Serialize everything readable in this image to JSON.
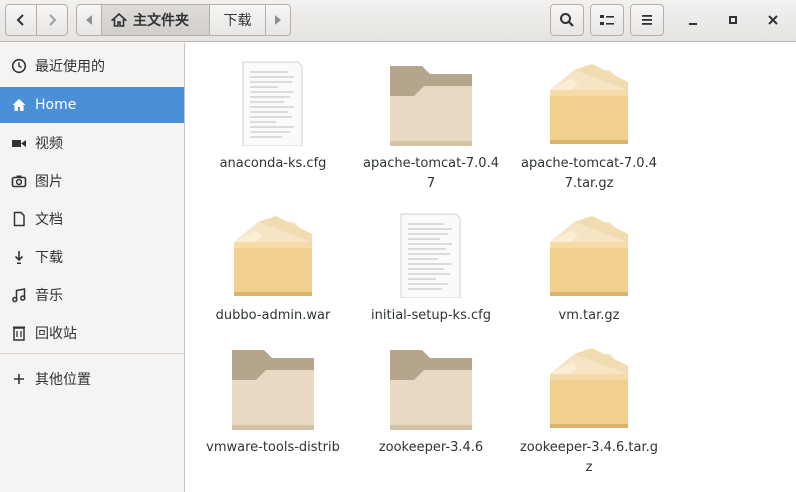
{
  "header": {
    "breadcrumbs": [
      {
        "label": "主文件夹",
        "icon": "home-icon"
      },
      {
        "label": "下载"
      }
    ]
  },
  "sidebar": {
    "items": [
      {
        "label": "最近使用的",
        "icon": "clock-icon"
      },
      {
        "label": "Home",
        "icon": "home-icon",
        "active": true
      },
      {
        "label": "视频",
        "icon": "video-icon"
      },
      {
        "label": "图片",
        "icon": "camera-icon"
      },
      {
        "label": "文档",
        "icon": "document-icon"
      },
      {
        "label": "下载",
        "icon": "download-icon"
      },
      {
        "label": "音乐",
        "icon": "music-icon"
      },
      {
        "label": "回收站",
        "icon": "trash-icon"
      },
      {
        "label": "其他位置",
        "icon": "plus-icon"
      }
    ]
  },
  "files": [
    {
      "name": "anaconda-ks.cfg",
      "type": "text"
    },
    {
      "name": "apache-tomcat-7.0.47",
      "type": "folder"
    },
    {
      "name": "apache-tomcat-7.0.47.tar.gz",
      "type": "archive"
    },
    {
      "name": "dubbo-admin.war",
      "type": "archive"
    },
    {
      "name": "initial-setup-ks.cfg",
      "type": "text"
    },
    {
      "name": "vm.tar.gz",
      "type": "archive"
    },
    {
      "name": "vmware-tools-distrib",
      "type": "folder"
    },
    {
      "name": "zookeeper-3.4.6",
      "type": "folder"
    },
    {
      "name": "zookeeper-3.4.6.tar.gz",
      "type": "archive"
    }
  ],
  "colors": {
    "accent": "#4a90d9",
    "folder": "#e8d4b8",
    "archive": "#f0cf8f"
  }
}
